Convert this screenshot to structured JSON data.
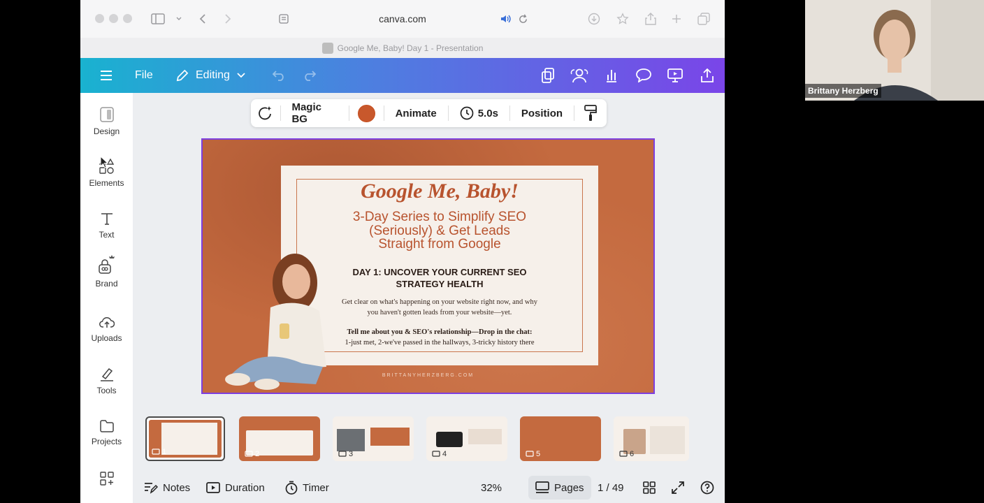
{
  "browser": {
    "url": "canva.com",
    "tab_title": "Google Me, Baby! Day 1 - Presentation"
  },
  "canva_bar": {
    "file_label": "File",
    "editing_label": "Editing"
  },
  "sidebar": {
    "items": [
      {
        "label": "Design"
      },
      {
        "label": "Elements"
      },
      {
        "label": "Text"
      },
      {
        "label": "Brand"
      },
      {
        "label": "Uploads"
      },
      {
        "label": "Tools"
      },
      {
        "label": "Projects"
      }
    ]
  },
  "context_toolbar": {
    "magic_bg": "Magic BG",
    "animate": "Animate",
    "duration": "5.0s",
    "position": "Position",
    "color": "#c8582c"
  },
  "slide": {
    "title": "Google Me, Baby!",
    "subtitle_line1": "3-Day Series to Simplify SEO",
    "subtitle_line2": "(Seriously) & Get Leads",
    "subtitle_line3": "Straight from Google",
    "heading_line1": "DAY 1: UNCOVER YOUR CURRENT SEO",
    "heading_line2": "STRATEGY HEALTH",
    "body_line1": "Get clear on what's happening on your website right now, and why",
    "body_line2": "you haven't gotten leads from your website—yet.",
    "cta_line1": "Tell me about you & SEO's relationship—Drop in the chat:",
    "cta_line2": "1-just met, 2-we've passed in the hallways, 3-tricky history there",
    "footer": "BRITTANYHERZBERG.COM"
  },
  "thumbnails": [
    {
      "num": "1"
    },
    {
      "num": "2"
    },
    {
      "num": "3"
    },
    {
      "num": "4"
    },
    {
      "num": "5"
    },
    {
      "num": "6"
    }
  ],
  "bottom_bar": {
    "notes": "Notes",
    "duration": "Duration",
    "timer": "Timer",
    "zoom": "32%",
    "pages": "Pages",
    "page_count": "1 / 49"
  },
  "webcam": {
    "name": "Brittany Herzberg"
  },
  "colors": {
    "accent": "#7d3fe0",
    "slide_bg": "#c46a3f",
    "slide_text": "#b8532e"
  }
}
